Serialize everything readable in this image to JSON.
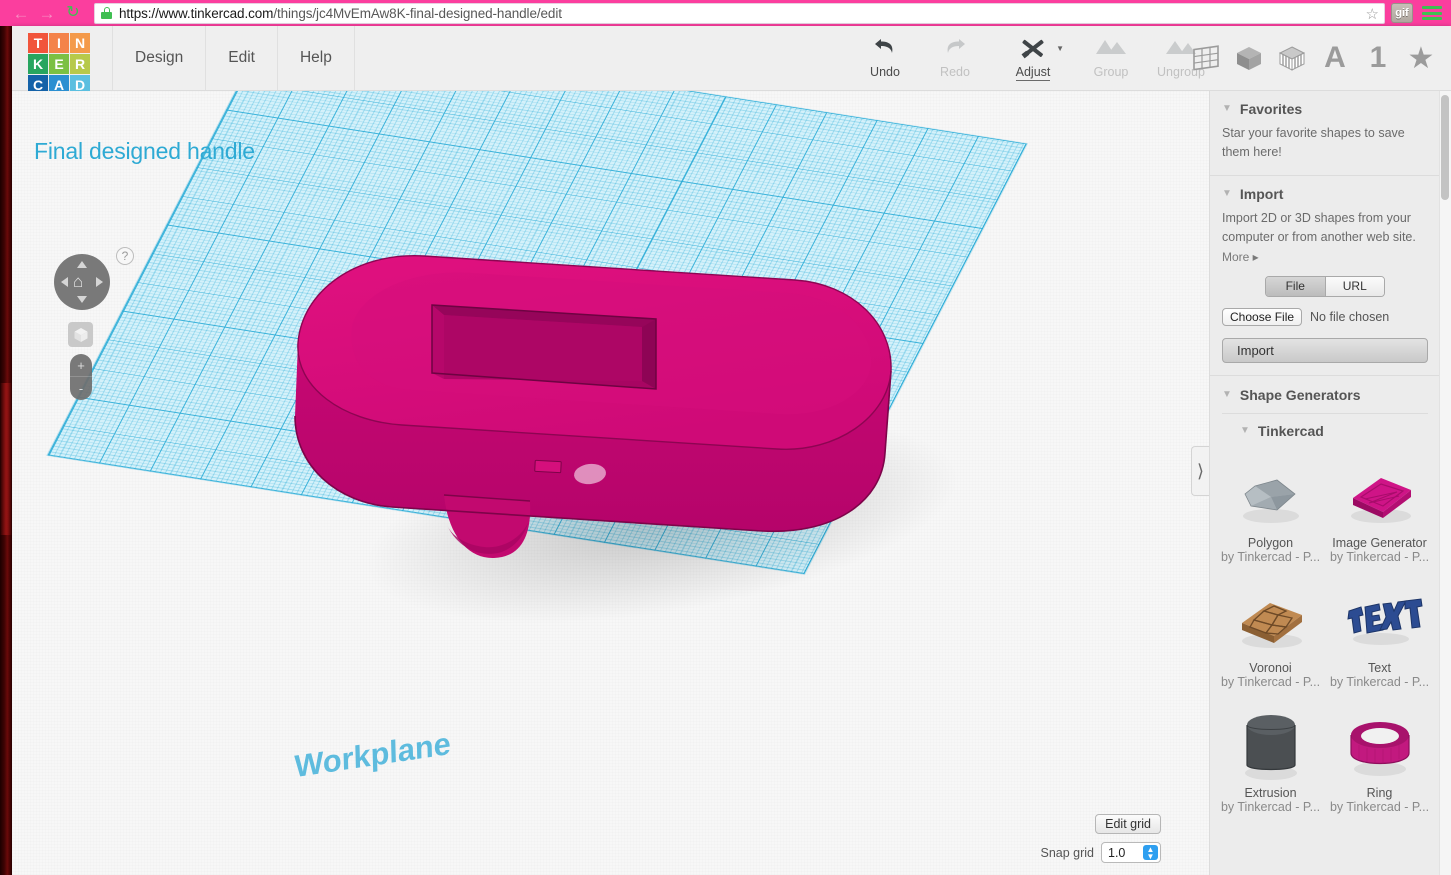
{
  "browser": {
    "back_icon": "arrow-left-icon",
    "forward_icon": "arrow-right-icon",
    "reload_icon": "reload-icon",
    "lock_icon": "lock-icon",
    "url_scheme": "https://",
    "url_host": "www.tinkercad.com",
    "url_path": "/things/jc4MvEmAw8K-final-designed-handle/edit",
    "url_full": "https://www.tinkercad.com/things/jc4MvEmAw8K-final-designed-handle/edit",
    "bookmark_icon": "star-outline-icon",
    "gif_extension_label": "gif",
    "menu_icon": "hamburger-menu-icon",
    "chrome_color": "#fb3e9e"
  },
  "logo": {
    "name": "tinkercad-logo",
    "tiles": [
      {
        "letter": "T",
        "color": "#f1553b"
      },
      {
        "letter": "I",
        "color": "#f4834a"
      },
      {
        "letter": "N",
        "color": "#f49a4a"
      },
      {
        "letter": "K",
        "color": "#28a55f"
      },
      {
        "letter": "E",
        "color": "#7bc043"
      },
      {
        "letter": "R",
        "color": "#b7c94a"
      },
      {
        "letter": "C",
        "color": "#1462a8"
      },
      {
        "letter": "A",
        "color": "#2b8fd1"
      },
      {
        "letter": "D",
        "color": "#5bbfe0"
      }
    ]
  },
  "menu": {
    "items": [
      {
        "label": "Design"
      },
      {
        "label": "Edit"
      },
      {
        "label": "Help"
      }
    ]
  },
  "tools": [
    {
      "label": "Undo",
      "icon": "undo-arrow-icon",
      "glyph": "↶",
      "enabled": true,
      "active": false
    },
    {
      "label": "Redo",
      "icon": "redo-arrow-icon",
      "glyph": "↷",
      "enabled": false,
      "active": false
    },
    {
      "label": "Adjust",
      "icon": "adjust-tools-icon",
      "glyph": "",
      "enabled": true,
      "active": true
    },
    {
      "label": "Group",
      "icon": "group-shapes-icon",
      "glyph": "",
      "enabled": false,
      "active": false
    },
    {
      "label": "Ungroup",
      "icon": "ungroup-shapes-icon",
      "glyph": "",
      "enabled": false,
      "active": false
    }
  ],
  "right_icons": [
    {
      "name": "workplane-grid-icon",
      "kind": "svg-grid"
    },
    {
      "name": "solid-cube-icon",
      "kind": "svg-cube-solid"
    },
    {
      "name": "striped-cube-icon",
      "kind": "svg-cube-striped"
    },
    {
      "name": "text-tool-icon",
      "kind": "text",
      "glyph": "A"
    },
    {
      "name": "number-tool-icon",
      "kind": "text",
      "glyph": "1"
    },
    {
      "name": "favorites-star-icon",
      "kind": "star",
      "glyph": "★"
    }
  ],
  "canvas": {
    "design_title": "Final designed handle",
    "workplane_label": "Workplane",
    "workplane_color": "#d4f1fa",
    "grid_line_color": "#29abd6",
    "model_color": "#d10a7a",
    "model_name": "designed-handle-solid",
    "nav": {
      "home_icon": "home-view-icon",
      "up_arrow": "pan-up-icon",
      "down_arrow": "pan-down-icon",
      "left_arrow": "pan-left-icon",
      "right_arrow": "pan-right-icon",
      "help_label": "?",
      "fit_view_icon": "fit-to-view-cube-icon",
      "zoom_in_label": "+",
      "zoom_out_label": "-"
    },
    "edit_grid_label": "Edit grid",
    "snap_grid_label": "Snap grid",
    "snap_grid_value": "1.0",
    "panel_handle_icon": "chevron-right-icon"
  },
  "sidebar": {
    "favorites": {
      "title": "Favorites",
      "description": "Star your favorite shapes to save them here!"
    },
    "import": {
      "title": "Import",
      "description": "Import 2D or 3D shapes from your computer or from another web site.",
      "more_label": "More ▸",
      "tab_file": "File",
      "tab_url": "URL",
      "choose_file_label": "Choose File",
      "no_file_text": "No file chosen",
      "import_button": "Import"
    },
    "shape_generators": {
      "title": "Shape Generators",
      "subgroup": "Tinkercad",
      "shapes": [
        {
          "name": "Polygon",
          "author": "by Tinkercad - P...",
          "thumb": "polygon-shape-thumb",
          "color": "#8f9aa0"
        },
        {
          "name": "Image Generator",
          "author": "by Tinkercad - P...",
          "thumb": "image-generator-thumb",
          "color": "#c2197f"
        },
        {
          "name": "Voronoi",
          "author": "by Tinkercad - P...",
          "thumb": "voronoi-shape-thumb",
          "color": "#b07a47"
        },
        {
          "name": "Text",
          "author": "by Tinkercad - P...",
          "thumb": "text-shape-thumb",
          "color": "#27478c"
        },
        {
          "name": "Extrusion",
          "author": "by Tinkercad - P...",
          "thumb": "extrusion-shape-thumb",
          "color": "#46494c"
        },
        {
          "name": "Ring",
          "author": "by Tinkercad - P...",
          "thumb": "ring-shape-thumb",
          "color": "#c2197f"
        }
      ]
    }
  }
}
